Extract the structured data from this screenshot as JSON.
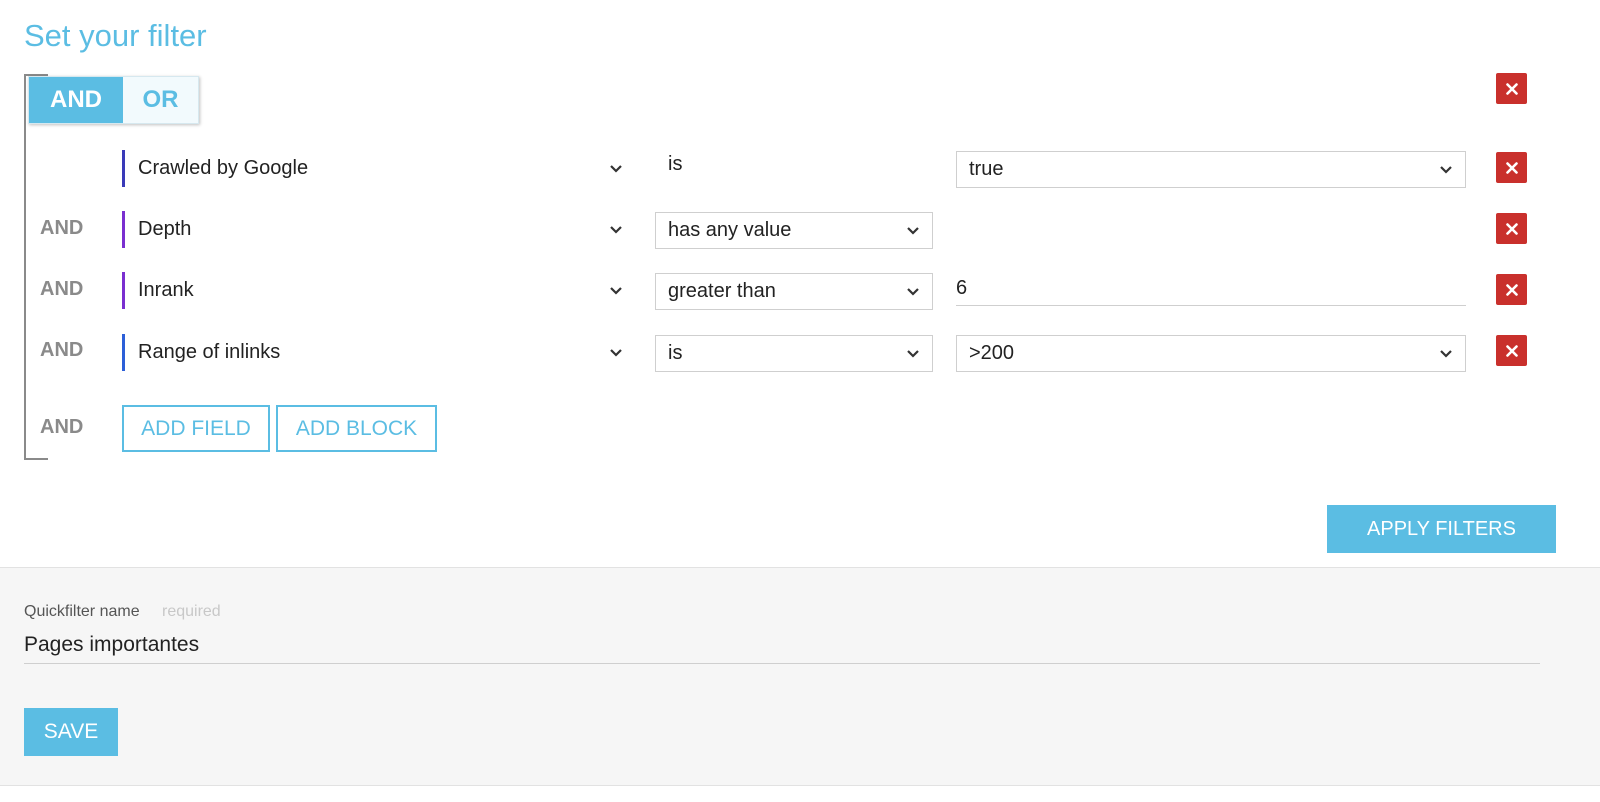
{
  "title": "Set your filter",
  "logic_toggle": {
    "and_label": "AND",
    "or_label": "OR",
    "selected": "AND"
  },
  "rows": [
    {
      "conjunction": "",
      "field": "Crawled by Google",
      "field_color": "#3a3ab8",
      "operator": "is",
      "value": "true"
    },
    {
      "conjunction": "AND",
      "field": "Depth",
      "field_color": "#7a2fd0",
      "operator": "has any value",
      "value": ""
    },
    {
      "conjunction": "AND",
      "field": "Inrank",
      "field_color": "#7a2fd0",
      "operator": "greater than",
      "value": "6"
    },
    {
      "conjunction": "AND",
      "field": "Range of inlinks",
      "field_color": "#2c5fd8",
      "operator": "is",
      "value": ">200"
    }
  ],
  "actions": {
    "conjunction": "AND",
    "add_field": "ADD FIELD",
    "add_block": "ADD BLOCK"
  },
  "apply_label": "APPLY FILTERS",
  "quickfilter": {
    "label": "Quickfilter name",
    "required_hint": "required",
    "value": "Pages importantes"
  },
  "save_label": "SAVE",
  "colors": {
    "accent": "#5bbde3",
    "danger": "#c9302c"
  },
  "icons": {
    "delete": "close-icon",
    "dropdown": "chevron-down-icon"
  }
}
